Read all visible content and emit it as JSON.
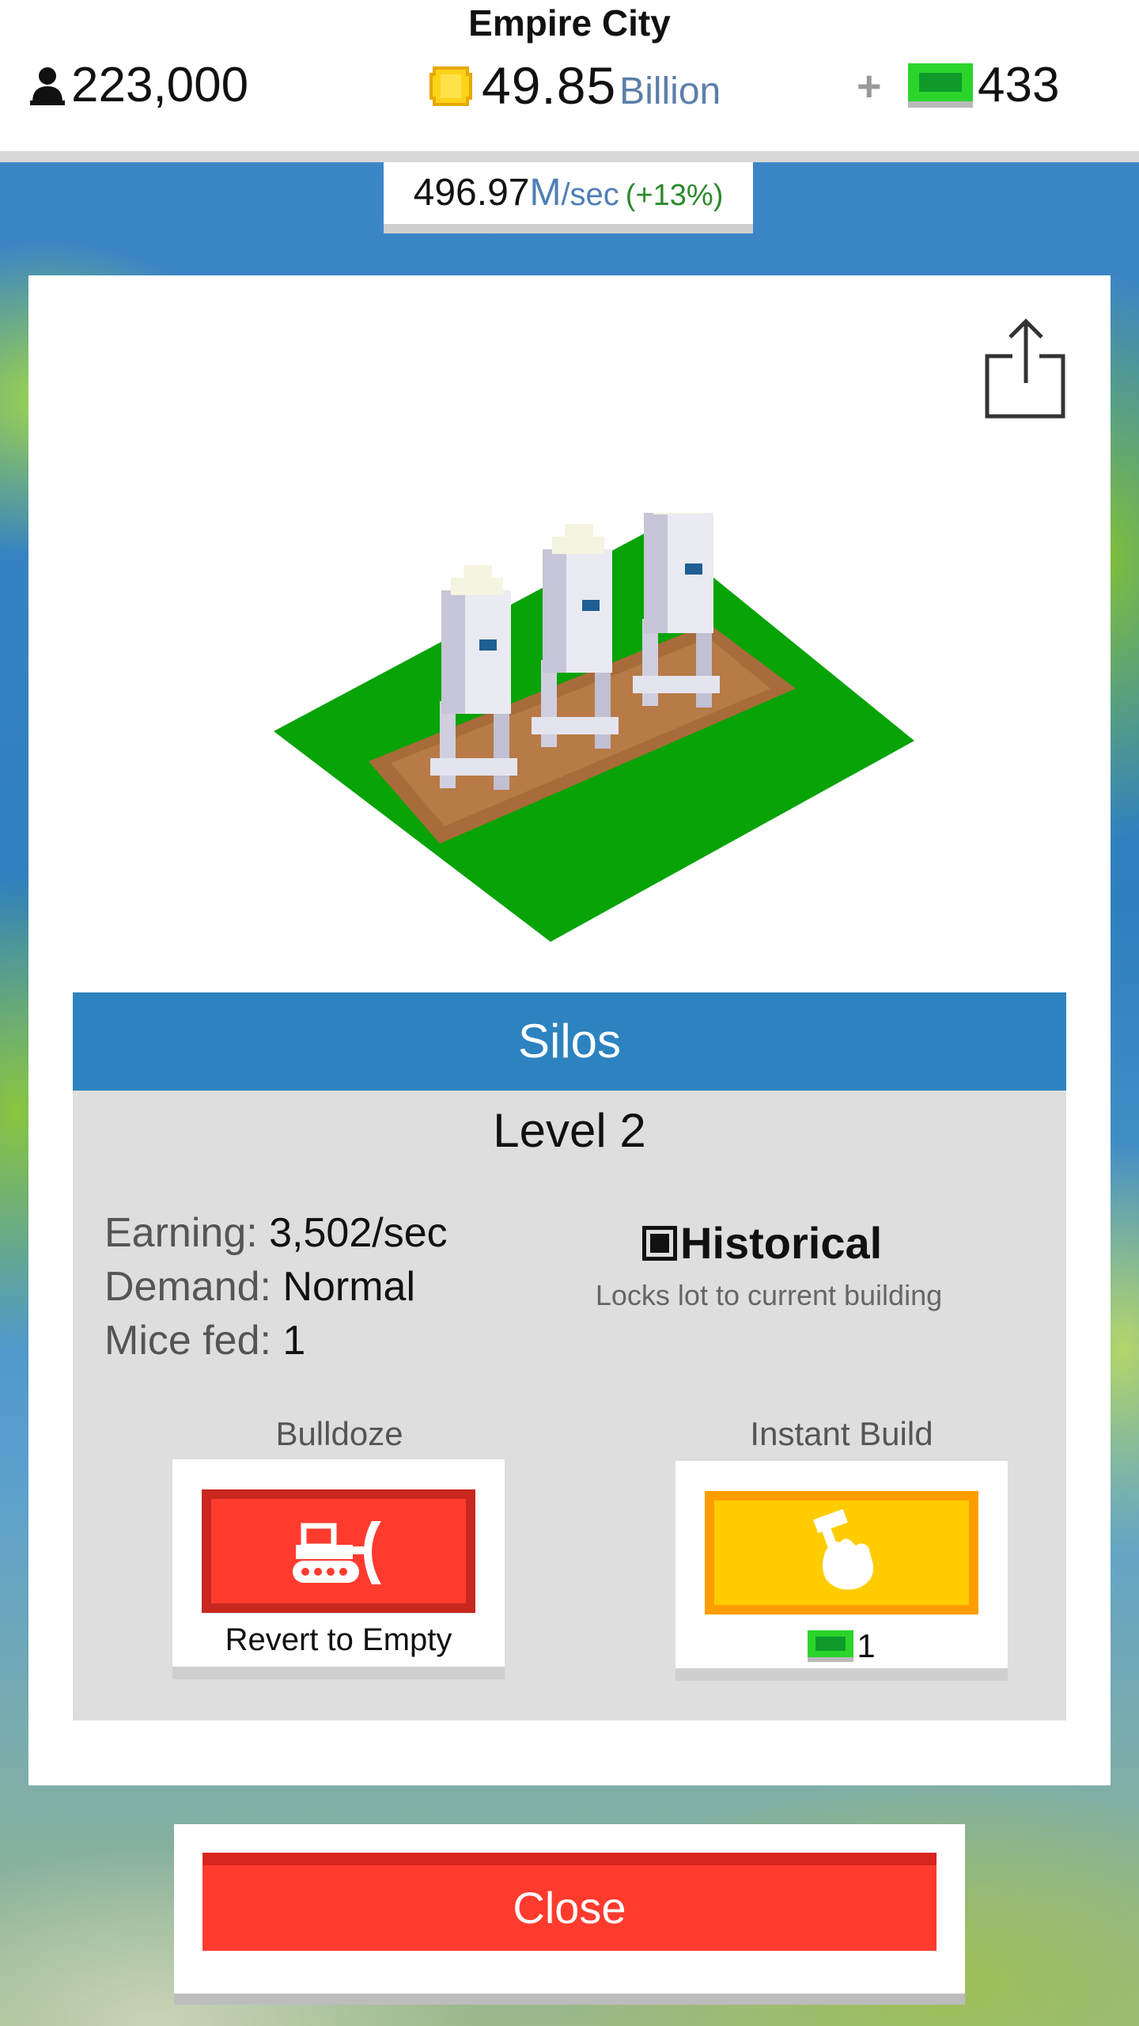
{
  "header": {
    "city_name": "Empire City",
    "population": "223,000",
    "coins": "49.85",
    "coins_unit": "Billion",
    "plus": "+",
    "cash": "433"
  },
  "rate": {
    "value": "496.97",
    "unit": "M",
    "per": "/sec",
    "change": "(+13%)"
  },
  "building": {
    "name": "Silos",
    "level": "Level 2",
    "stats": [
      {
        "label": "Earning: ",
        "value": "3,502/sec"
      },
      {
        "label": "Demand: ",
        "value": "Normal"
      },
      {
        "label": "Mice fed: ",
        "value": "1"
      }
    ],
    "historical": {
      "label": "Historical",
      "description": "Locks lot to current building",
      "checked": true
    }
  },
  "actions": {
    "bulldoze": {
      "caption": "Bulldoze",
      "label": "Revert to Empty",
      "icon": "bulldozer-icon"
    },
    "instant_build": {
      "caption": "Instant Build",
      "cost": "1",
      "icon": "hammer-hand-icon"
    }
  },
  "close_label": "Close",
  "colors": {
    "title_bar": "#2d83c0",
    "bulldoze_red": "#ff3b2e",
    "instant_yellow": "#ffcc00",
    "cash_green": "#2bd42b",
    "grass_green": "#07a307"
  }
}
